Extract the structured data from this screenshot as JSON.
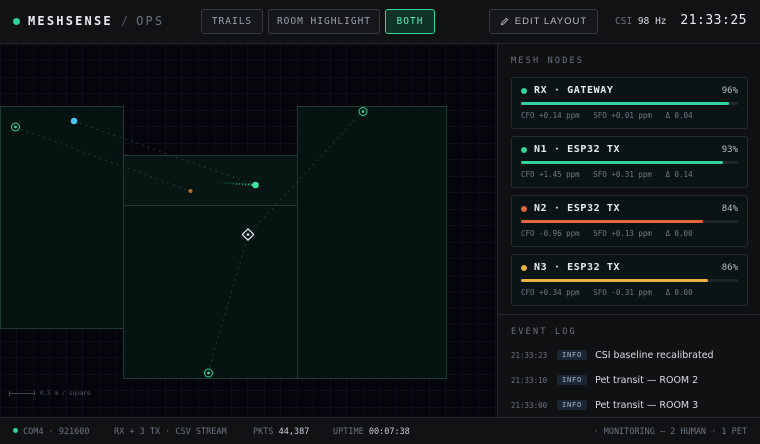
{
  "header": {
    "brand": "MESHSENSE",
    "brand_sub": "OPS",
    "modes": [
      "TRAILS",
      "ROOM HIGHLIGHT",
      "BOTH"
    ],
    "active_mode": "BOTH",
    "edit_layout": "EDIT LAYOUT",
    "csi_label": "CSI",
    "csi_rate": "98 Hz",
    "clock": "21:33:25"
  },
  "map": {
    "scale_label": "0.5 m / square",
    "icons": [
      "router-icon",
      "person-marker-icon",
      "pet-marker-icon",
      "device-marker-icon"
    ]
  },
  "panel": {
    "nodes_title": "MESH NODES",
    "nodes": [
      {
        "name": "RX · GATEWAY",
        "pct": "96%",
        "level": 0.96,
        "color": "#34d39b",
        "stats": "CFO +0.14 ppm   SFO +0.01 ppm   Δ 0.04"
      },
      {
        "name": "N1 · ESP32 TX",
        "pct": "93%",
        "level": 0.93,
        "color": "#34d39b",
        "stats": "CFO +1.45 ppm   SFO +0.31 ppm   Δ 0.14"
      },
      {
        "name": "N2 · ESP32 TX",
        "pct": "84%",
        "level": 0.84,
        "color": "#e0663f",
        "stats": "CFO -0.96 ppm   SFO +0.13 ppm   Δ 0.00"
      },
      {
        "name": "N3 · ESP32 TX",
        "pct": "86%",
        "level": 0.86,
        "color": "#e8b341",
        "stats": "CFO +0.34 ppm   SFO -0.31 ppm   Δ 0.00"
      }
    ],
    "log_title": "EVENT LOG",
    "events": [
      {
        "time": "21:33:23",
        "level": "INFO",
        "msg": "CSI baseline recalibrated"
      },
      {
        "time": "21:33:10",
        "level": "INFO",
        "msg": "Pet transit — ROOM 2"
      },
      {
        "time": "21:33:00",
        "level": "INFO",
        "msg": "Pet transit — ROOM 3"
      }
    ]
  },
  "footer": {
    "port": "COM4 · 921600",
    "stream": "RX + 3 TX · CSV STREAM",
    "pkts_label": "PKTS",
    "pkts": "44,387",
    "uptime_label": "UPTIME",
    "uptime": "00:07:38",
    "monitoring": "· MONITORING — 2 HUMAN · 1 PET"
  }
}
